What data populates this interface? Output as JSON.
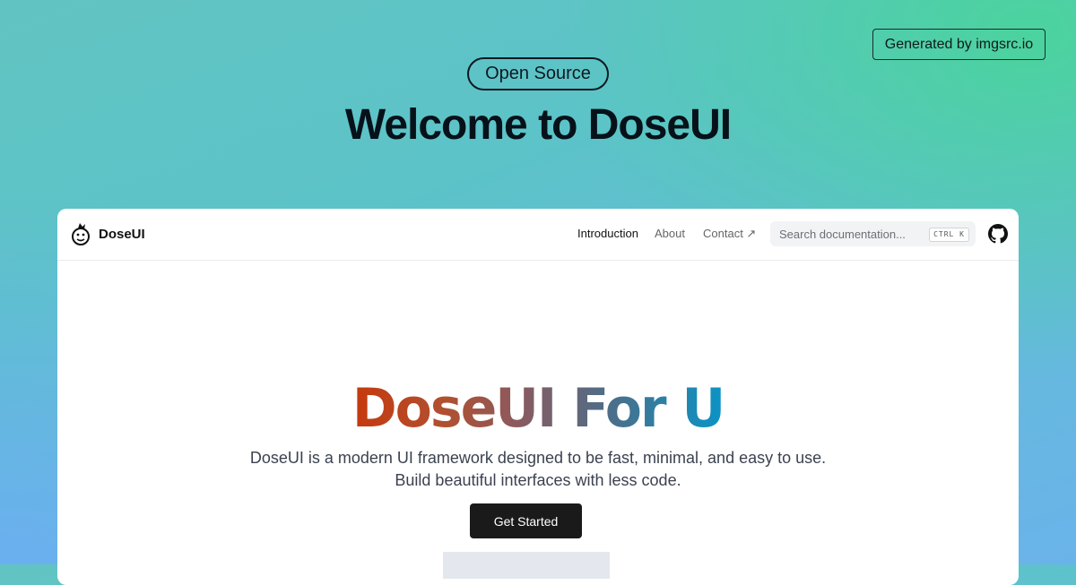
{
  "banner": {
    "generated_by": "Generated by imgsrc.io",
    "badge": "Open Source",
    "headline": "Welcome to DoseUI"
  },
  "app": {
    "brand": "DoseUI",
    "nav": {
      "introduction": "Introduction",
      "about": "About",
      "contact": "Contact ↗"
    },
    "search": {
      "placeholder": "Search documentation...",
      "shortcut": "CTRL K"
    },
    "icons": {
      "logo": "doseui-logo-icon",
      "github": "github-icon"
    }
  },
  "hero": {
    "title": "DoseUI For U",
    "description": "DoseUI is a modern UI framework designed to be fast, minimal, and easy to use. Build beautiful interfaces with less code.",
    "primary_button": "Get Started"
  },
  "colors": {
    "background_start": "#62c4c2",
    "background_end": "#6ab3ea",
    "title_gradient_start": "#c6390d",
    "title_gradient_end": "#0a94c6",
    "button_bg": "#1a1a1a"
  }
}
